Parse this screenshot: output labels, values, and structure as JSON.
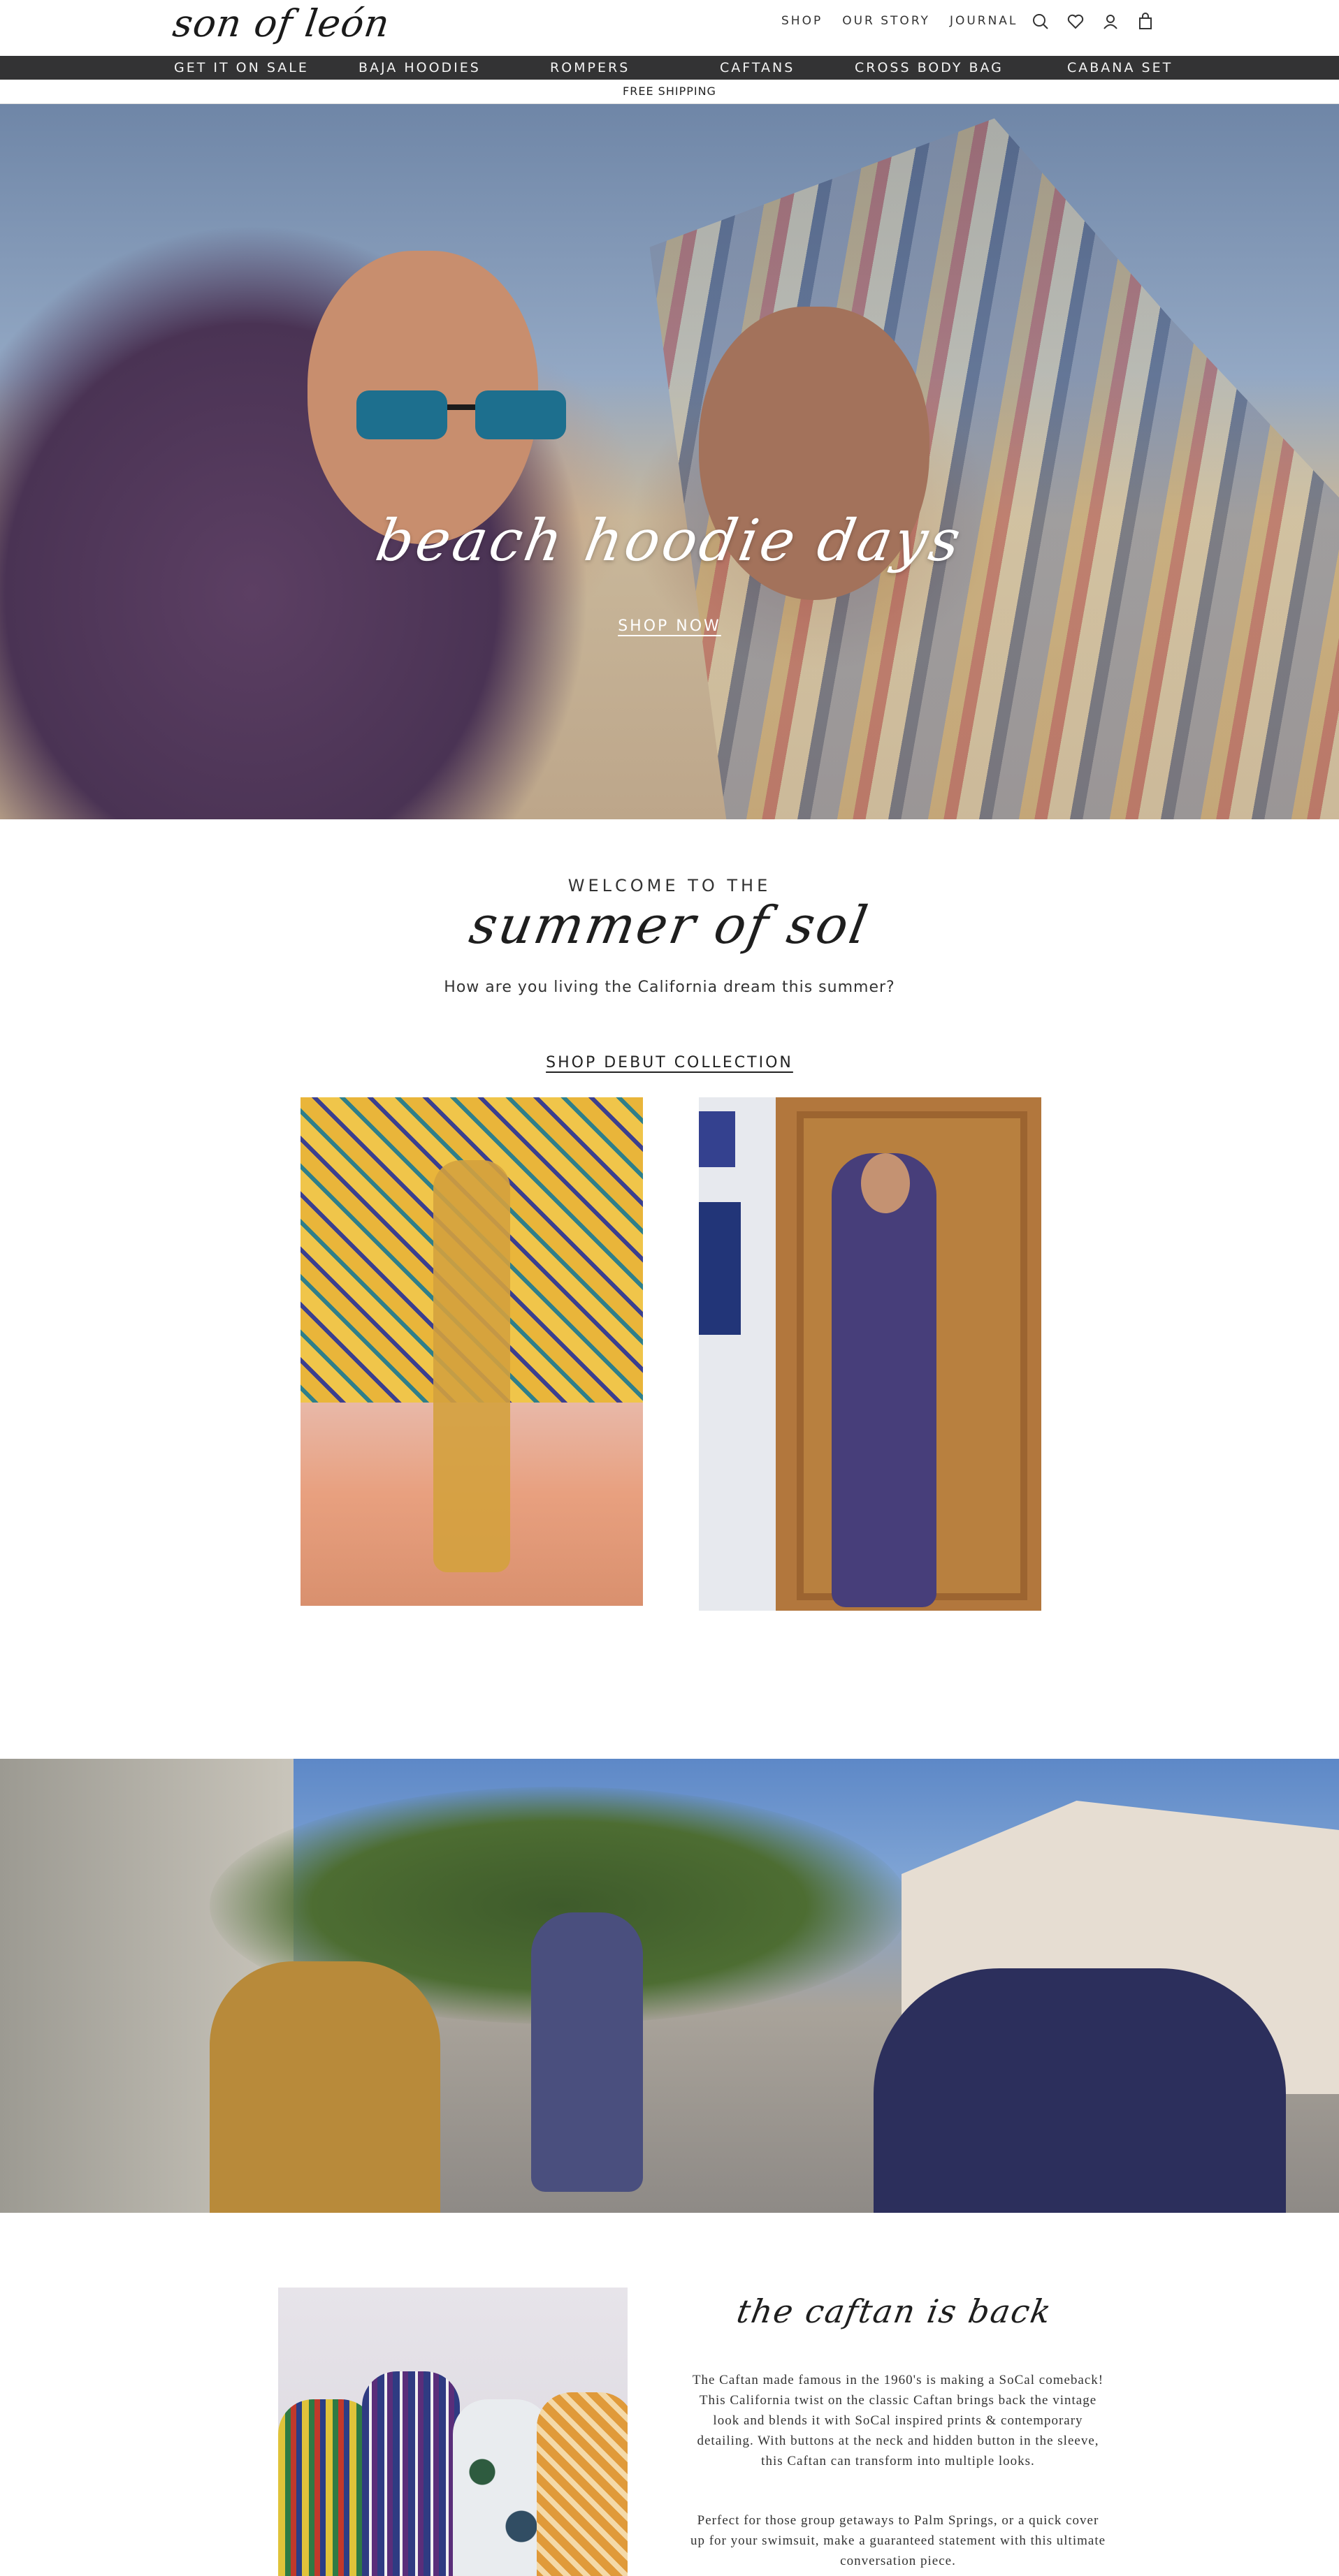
{
  "header": {
    "logo": "son of león",
    "nav": [
      "SHOP",
      "OUR STORY",
      "JOURNAL"
    ],
    "icons": [
      "search-icon",
      "heart-icon",
      "account-icon",
      "cart-icon"
    ]
  },
  "categories": [
    "GET IT ON SALE",
    "BAJA HOODIES",
    "ROMPERS",
    "CAFTANS",
    "CROSS BODY BAG",
    "CABANA SET"
  ],
  "announcement": "FREE SHIPPING",
  "hero": {
    "title": "beach hoodie days",
    "cta": "SHOP NOW"
  },
  "welcome": {
    "pre": "WELCOME TO THE",
    "title": "summer of sol",
    "subtitle": "How are you living the California dream this summer?",
    "cta": "SHOP DEBUT COLLECTION"
  },
  "caftan": {
    "title": "the caftan is back",
    "p1": "The Caftan made famous in the 1960's is making a SoCal comeback! This California twist on the classic Caftan brings back the vintage look and blends it with SoCal inspired prints & contemporary detailing. With buttons at the neck and hidden button in the sleeve, this Caftan can transform into multiple looks.",
    "p2": "Perfect for those group getaways to Palm Springs, or a quick cover up for your swimsuit, make a guaranteed statement with this ultimate conversation piece."
  },
  "colors": {
    "category_bar": "#333334",
    "text": "#222222"
  }
}
